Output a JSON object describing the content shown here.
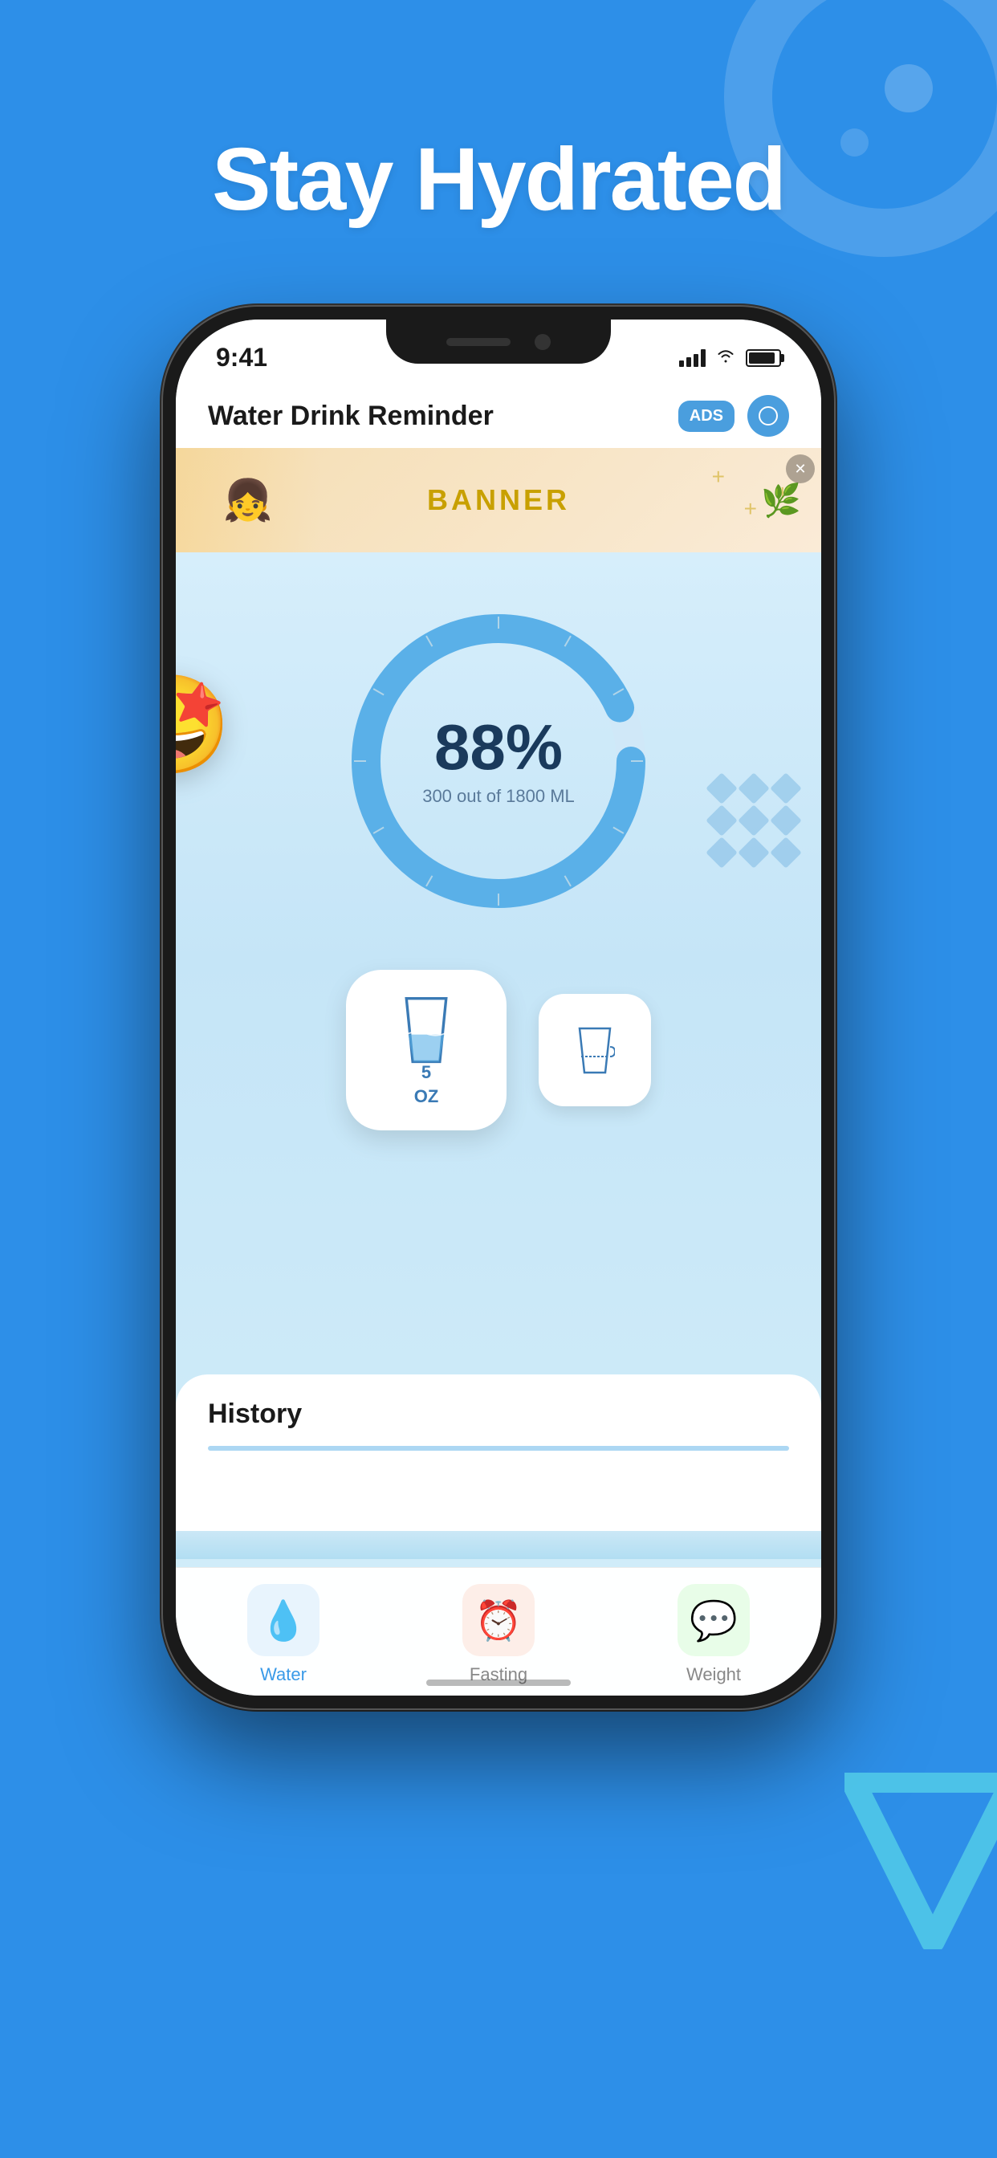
{
  "page": {
    "title": "Stay Hydrated",
    "background_color": "#2d8fe8"
  },
  "status_bar": {
    "time": "9:41",
    "signal_bars": 4,
    "wifi": true,
    "battery_full": true
  },
  "app_header": {
    "title": "Water Drink Reminder",
    "ads_label": "ADS",
    "settings_icon": "circle"
  },
  "banner": {
    "text": "BANNER",
    "close_icon": "✕"
  },
  "progress": {
    "percent": "88%",
    "consumed_ml": 300,
    "total_ml": 1800,
    "label": "300 out of 1800 ML",
    "emoji": "🤩"
  },
  "drink_buttons": {
    "primary": {
      "size": "5",
      "unit": "OZ"
    },
    "secondary_icon": "custom-glass"
  },
  "history": {
    "title": "History"
  },
  "tabs": [
    {
      "id": "water",
      "label": "Water",
      "icon": "💧",
      "active": true,
      "bg": "#e8f4fd"
    },
    {
      "id": "fasting",
      "label": "Fasting",
      "icon": "⏰",
      "active": false,
      "bg": "#fdeee8"
    },
    {
      "id": "weight",
      "label": "Weight",
      "icon": "💬",
      "active": false,
      "bg": "#e8fde8"
    }
  ]
}
